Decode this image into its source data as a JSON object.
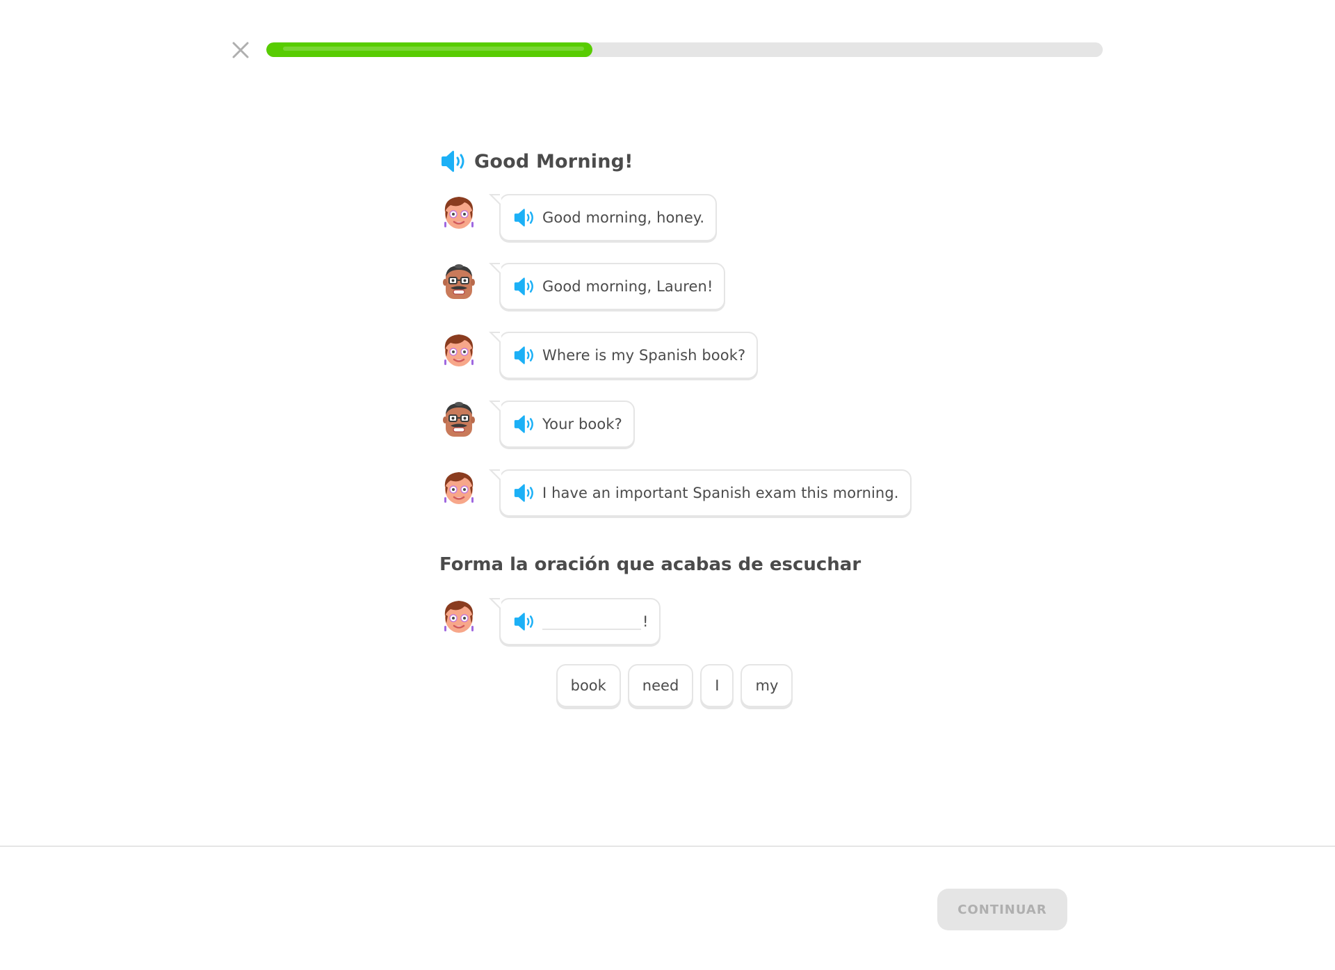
{
  "progress": {
    "fraction": 0.39
  },
  "story": {
    "title": "Good Morning!",
    "lines": [
      {
        "speaker": "woman",
        "text": "Good morning, honey."
      },
      {
        "speaker": "man",
        "text": "Good morning, Lauren!"
      },
      {
        "speaker": "woman",
        "text": "Where is my Spanish book?"
      },
      {
        "speaker": "man",
        "text": "Your book?"
      },
      {
        "speaker": "woman",
        "text": "I have an important Spanish exam this morning."
      }
    ]
  },
  "exercise": {
    "prompt": "Forma la oración que acabas de escuchar",
    "answer_suffix": "!",
    "word_bank": [
      "book",
      "need",
      "I",
      "my"
    ]
  },
  "footer": {
    "continue_label": "CONTINUAR"
  },
  "colors": {
    "accent_blue": "#1cb0f6",
    "progress_green": "#58cc02",
    "border_gray": "#e5e5e5",
    "text_dark": "#4b4b4b"
  },
  "icons": {
    "close": "close-icon",
    "speaker": "speaker-icon"
  }
}
